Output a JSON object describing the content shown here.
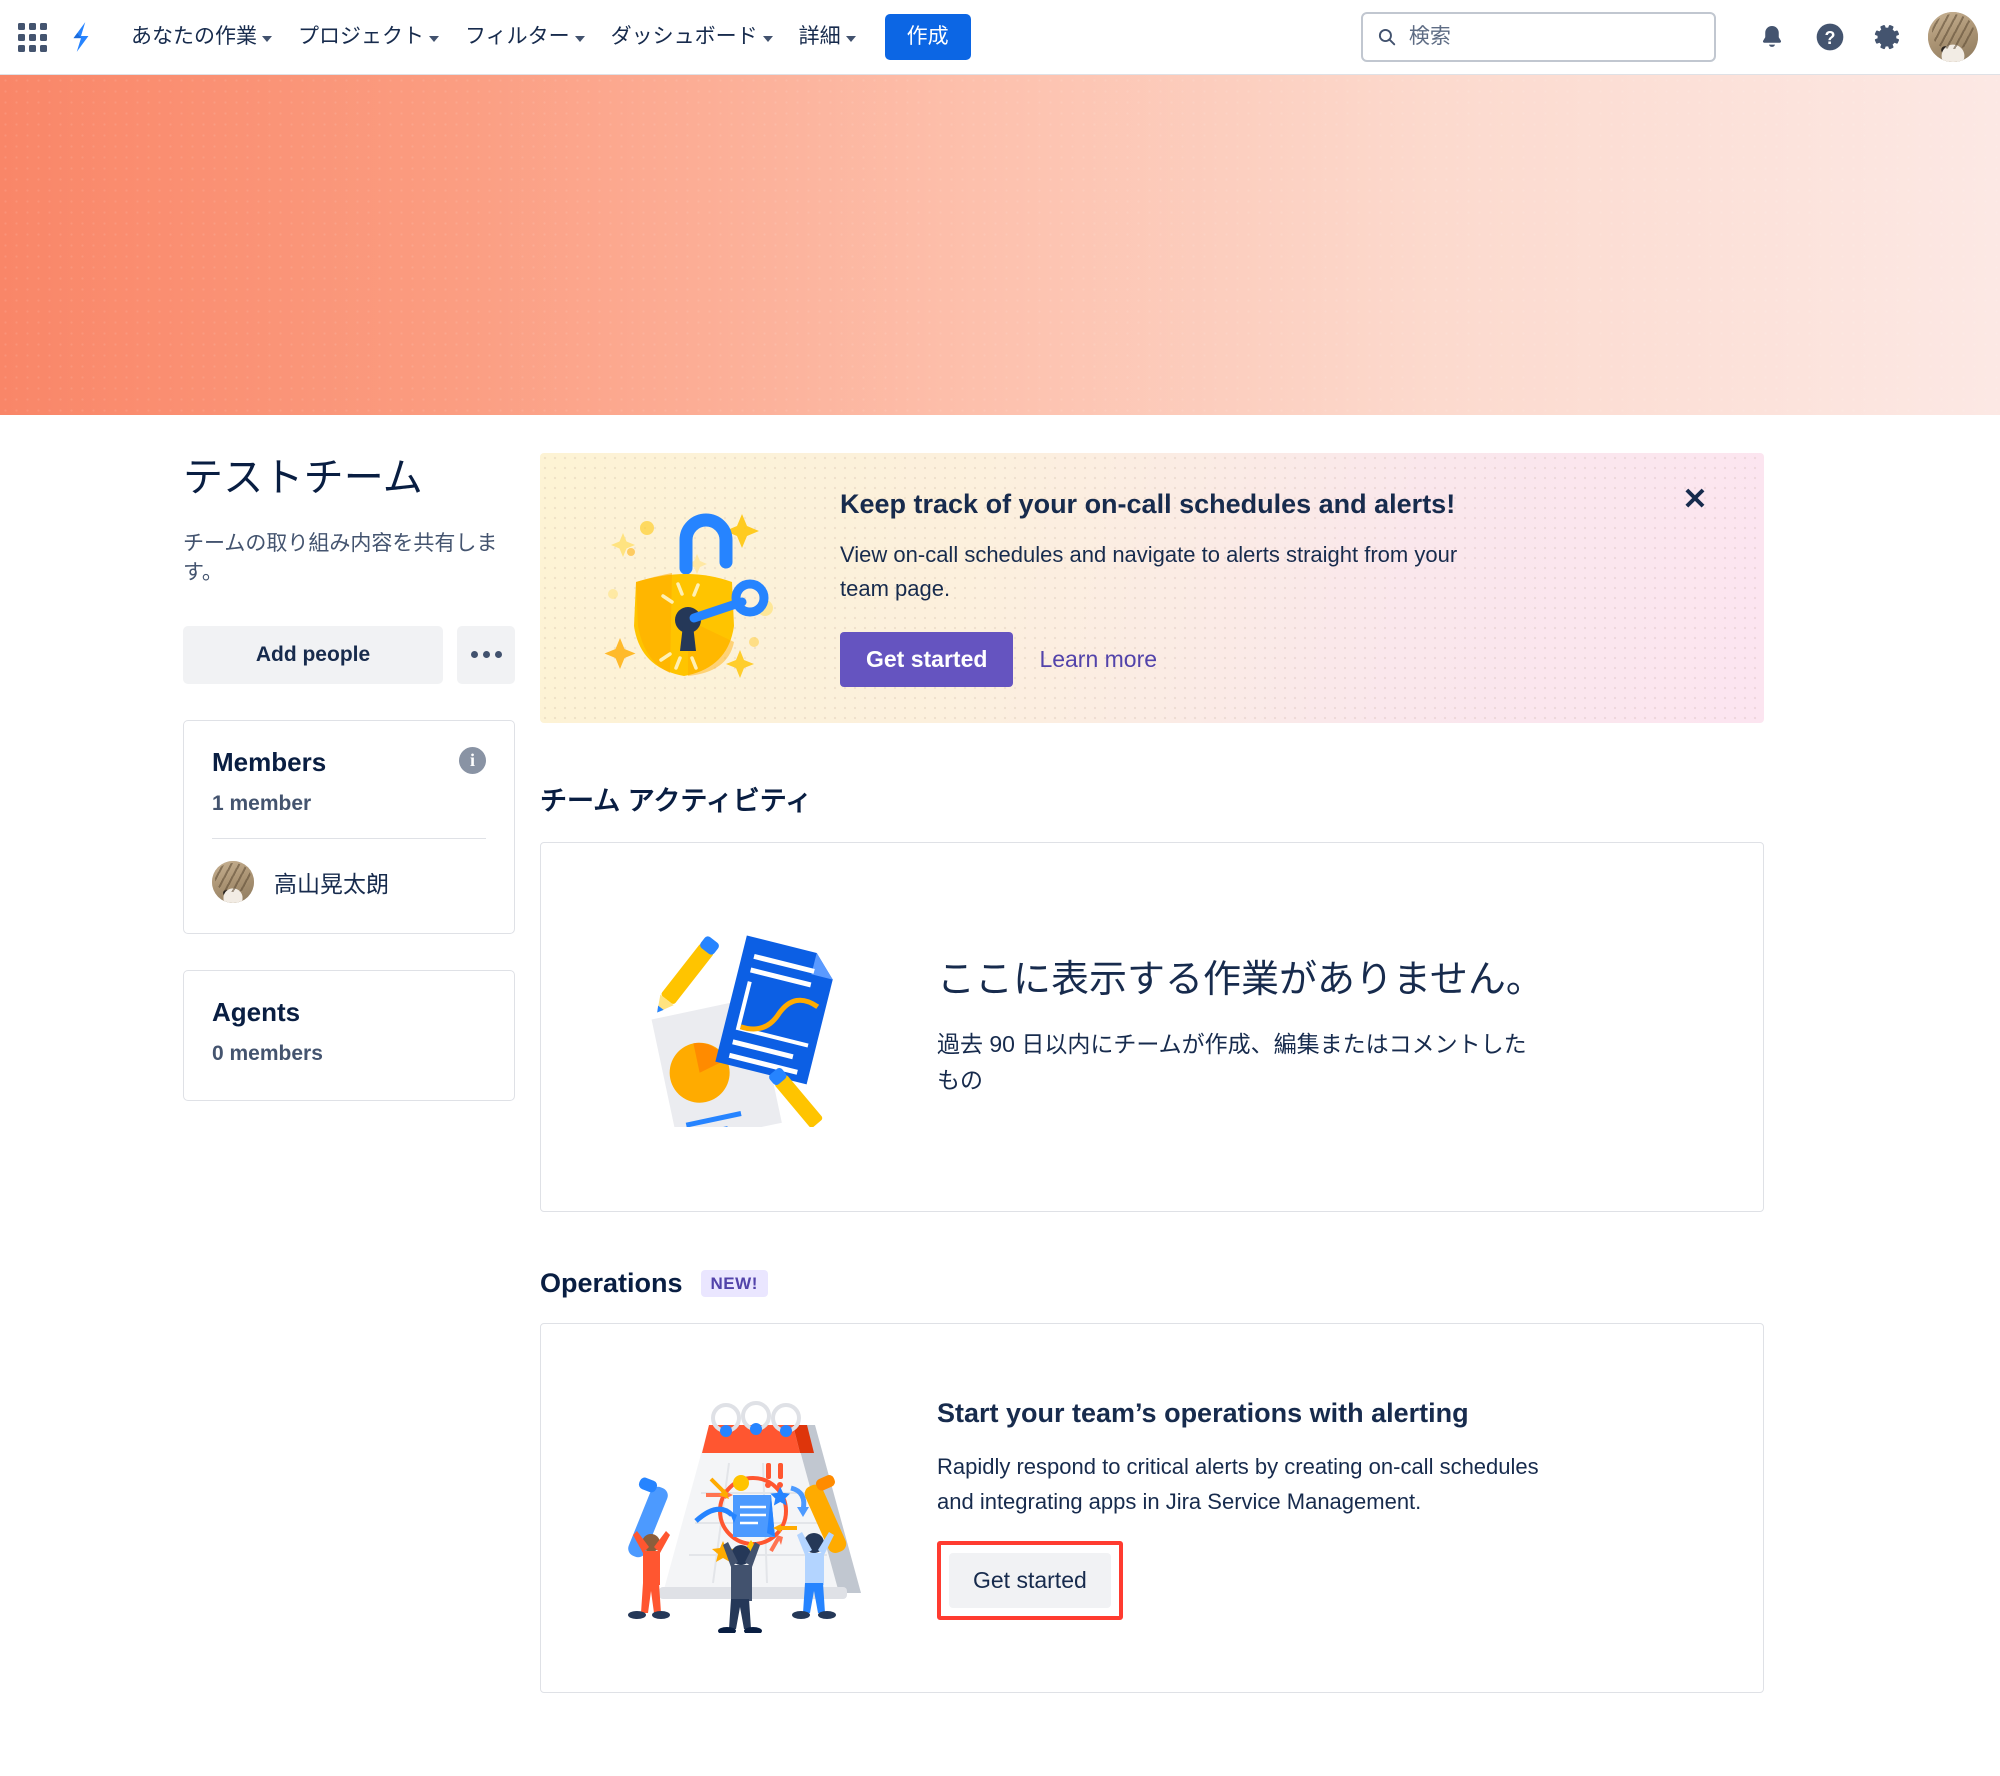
{
  "nav": {
    "app_switcher_icon": "grid-apps-icon",
    "logo_icon": "jira-logo-icon",
    "items": [
      {
        "label": "あなたの作業",
        "has_chevron": true
      },
      {
        "label": "プロジェクト",
        "has_chevron": true
      },
      {
        "label": "フィルター",
        "has_chevron": true
      },
      {
        "label": "ダッシュボード",
        "has_chevron": true
      },
      {
        "label": "詳細",
        "has_chevron": true
      }
    ],
    "create_label": "作成",
    "search_placeholder": "検索",
    "search_value": "",
    "search_icon": "search-icon",
    "notifications_icon": "bell-icon",
    "help_icon": "help-circle-icon",
    "settings_icon": "gear-icon",
    "avatar_icon": "user-avatar"
  },
  "hero": {
    "gradient_from": "#F98668",
    "gradient_to": "#FCE8E4"
  },
  "team": {
    "title": "テストチーム",
    "description": "チームの取り組み内容を共有します。",
    "add_people_label": "Add people",
    "more_label": "more-actions",
    "members_card": {
      "title": "Members",
      "count_label": "1 member",
      "info_icon": "info-icon",
      "members": [
        {
          "name": "高山晃太朗",
          "avatar": "member-avatar"
        }
      ]
    },
    "agents_card": {
      "title": "Agents",
      "count_label": "0 members"
    }
  },
  "promo": {
    "title": "Keep track of your on-call schedules and alerts!",
    "text": "View on-call schedules and navigate to alerts straight from your team page.",
    "primary_label": "Get started",
    "secondary_label": "Learn more",
    "close_label": "✕",
    "art_icon": "padlock-key-illustration",
    "accent_color": "#6554C0"
  },
  "activity": {
    "section_title": "チーム アクティビティ",
    "empty_title": "ここに表示する作業がありません。",
    "empty_text": "過去 90 日以内にチームが作成、編集またはコメントしたもの",
    "art_icon": "documents-pencils-illustration"
  },
  "operations": {
    "section_title": "Operations",
    "badge": "NEW!",
    "title": "Start your team’s operations with alerting",
    "text": "Rapidly respond to critical alerts by creating on-call schedules and integrating apps in Jira Service Management.",
    "button_label": "Get started",
    "art_icon": "calendar-team-illustration",
    "highlight_color": "#FF3B30"
  }
}
